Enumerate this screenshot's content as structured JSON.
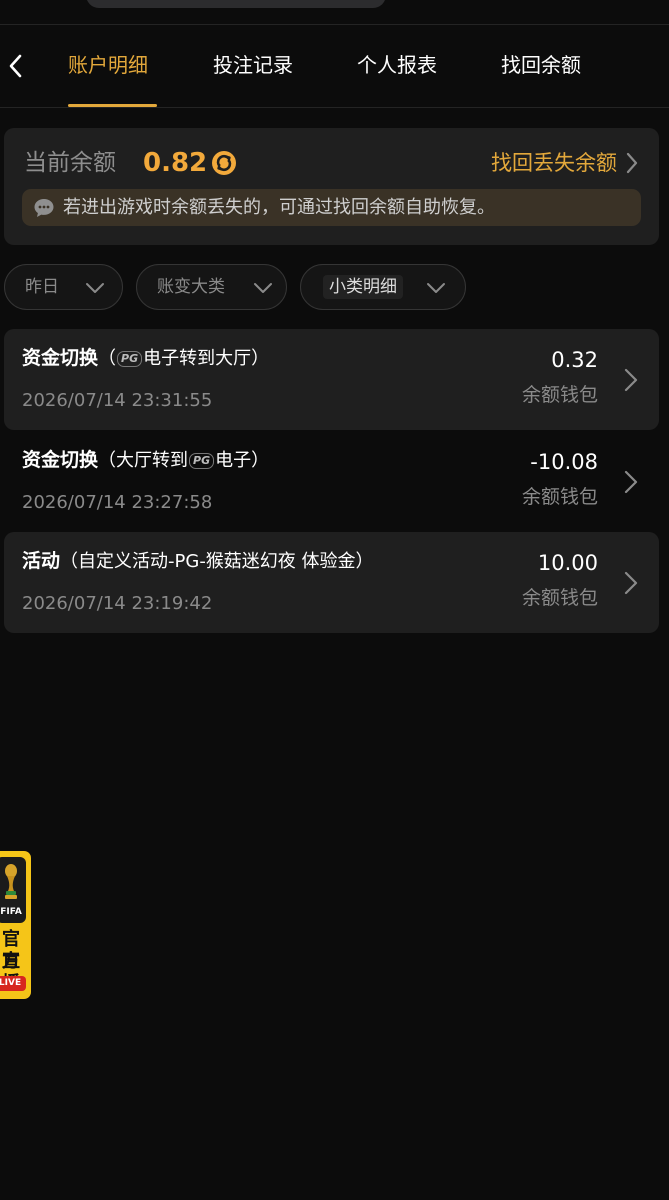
{
  "nav": {
    "tabs": [
      {
        "label": "账户明细",
        "active": true
      },
      {
        "label": "投注记录",
        "active": false
      },
      {
        "label": "个人报表",
        "active": false
      },
      {
        "label": "找回余额",
        "active": false
      }
    ]
  },
  "balance": {
    "label": "当前余额",
    "value": "0.82",
    "recover_link": "找回丢失余额",
    "tip": "若进出游戏时余额丢失的，可通过找回余额自助恢复。"
  },
  "filters": [
    {
      "label": "昨日"
    },
    {
      "label": "账变大类"
    },
    {
      "label": "小类明细"
    }
  ],
  "records": [
    {
      "type": "资金切换",
      "detail_prefix": "（",
      "pg_logo": "PG",
      "detail_suffix": "电子转到大厅）",
      "time": "2026/07/14 23:31:55",
      "amount": "0.32",
      "wallet": "余额钱包"
    },
    {
      "type": "资金切换",
      "detail_prefix": "（大厅转到",
      "pg_logo": "PG",
      "detail_suffix": "电子）",
      "time": "2026/07/14 23:27:58",
      "amount": "-10.08",
      "wallet": "余额钱包"
    },
    {
      "type": "活动",
      "detail_prefix": "（自定义活动-PG-猴菇迷幻夜 体验金）",
      "pg_logo": "",
      "detail_suffix": "",
      "time": "2026/07/14 23:19:42",
      "amount": "10.00",
      "wallet": "余额钱包"
    }
  ],
  "float_badge": {
    "fifa": "FIFA",
    "line1": "官方",
    "line2": "直播",
    "live": "LIVE"
  },
  "colors": {
    "accent": "#e3a83b",
    "balance_value": "#f2a93b",
    "background": "#0c0c0c",
    "card": "#1f1f1f"
  },
  "icons": {
    "back": "chevron-left-icon",
    "refresh": "refresh-icon",
    "recover": "chevron-right-icon",
    "tip": "chat-bubble-icon",
    "filter": "chevron-down-icon",
    "row": "chevron-right-icon"
  }
}
